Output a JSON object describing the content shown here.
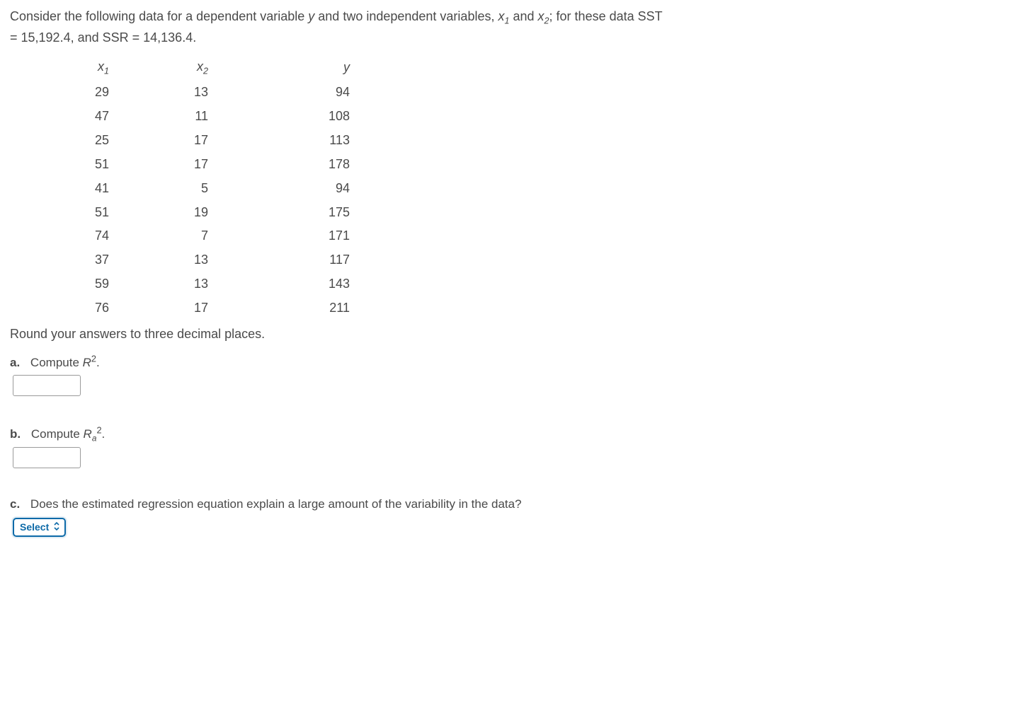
{
  "intro": {
    "line1_a": "Consider the following data for a dependent variable ",
    "y": "y",
    "line1_b": " and two independent variables, ",
    "x1": "x",
    "x1_sub": "1",
    "and": " and ",
    "x2": "x",
    "x2_sub": "2",
    "line1_c": "; for these data SST",
    "line2_a": "= 15,192.4, and SSR = 14,136.4."
  },
  "table": {
    "headers": {
      "h1": "x",
      "h1_sub": "1",
      "h2": "x",
      "h2_sub": "2",
      "h3": "y"
    },
    "rows": [
      {
        "x1": "29",
        "x2": "13",
        "y": "94"
      },
      {
        "x1": "47",
        "x2": "11",
        "y": "108"
      },
      {
        "x1": "25",
        "x2": "17",
        "y": "113"
      },
      {
        "x1": "51",
        "x2": "17",
        "y": "178"
      },
      {
        "x1": "41",
        "x2": "5",
        "y": "94"
      },
      {
        "x1": "51",
        "x2": "19",
        "y": "175"
      },
      {
        "x1": "74",
        "x2": "7",
        "y": "171"
      },
      {
        "x1": "37",
        "x2": "13",
        "y": "117"
      },
      {
        "x1": "59",
        "x2": "13",
        "y": "143"
      },
      {
        "x1": "76",
        "x2": "17",
        "y": "211"
      }
    ]
  },
  "instr": "Round your answers to three decimal places.",
  "parts": {
    "a": {
      "label": "a.",
      "text_pre": "Compute ",
      "sym": "R",
      "sup": "2",
      "text_post": "."
    },
    "b": {
      "label": "b.",
      "text_pre": "Compute ",
      "sym": "R",
      "sub": "a",
      "sup": "2",
      "text_post": "."
    },
    "c": {
      "label": "c.",
      "text": "Does the estimated regression equation explain a large amount of the variability in the data?"
    }
  },
  "select": {
    "label": "Select",
    "icon": "⌃⌄"
  },
  "inputs": {
    "a_value": "",
    "b_value": ""
  }
}
